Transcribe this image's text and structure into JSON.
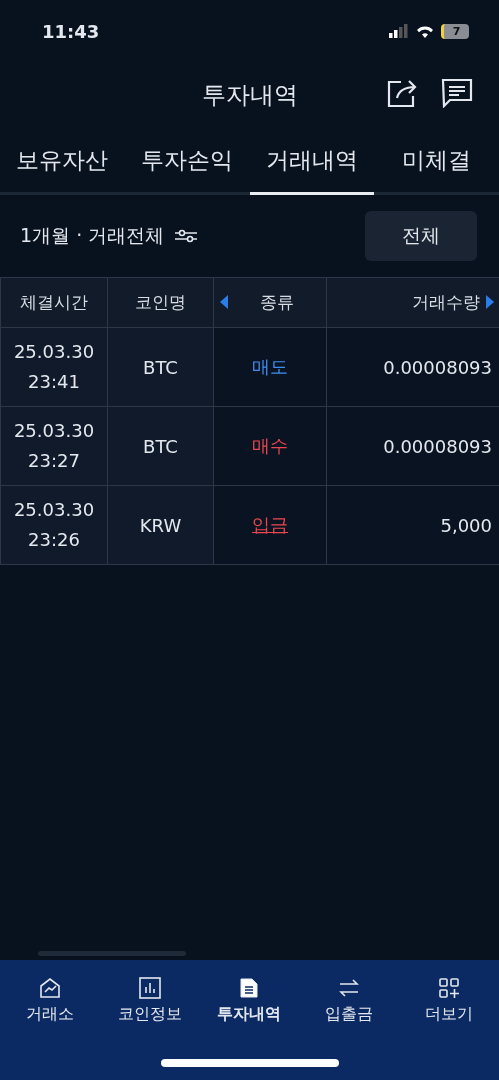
{
  "status_bar": {
    "time": "11:43",
    "battery": "7"
  },
  "header": {
    "title": "투자내역"
  },
  "tabs": [
    {
      "label": "보유자산",
      "selected": false
    },
    {
      "label": "투자손익",
      "selected": false
    },
    {
      "label": "거래내역",
      "selected": true
    },
    {
      "label": "미체결",
      "selected": false
    }
  ],
  "filter": {
    "label": "1개월 · 거래전체",
    "button": "전체"
  },
  "table": {
    "columns": [
      "체결시간",
      "코인명",
      "종류",
      "거래수량"
    ],
    "rows": [
      {
        "date": "25.03.30",
        "time": "23:41",
        "coin": "BTC",
        "type": {
          "label": "매도",
          "kind": "sell"
        },
        "amount": "0.00008093"
      },
      {
        "date": "25.03.30",
        "time": "23:27",
        "coin": "BTC",
        "type": {
          "label": "매수",
          "kind": "buy"
        },
        "amount": "0.00008093"
      },
      {
        "date": "25.03.30",
        "time": "23:26",
        "coin": "KRW",
        "type": {
          "label": "입금",
          "kind": "deposit"
        },
        "amount": "5,000"
      }
    ]
  },
  "bottom_nav": [
    {
      "label": "거래소",
      "kind": "chart",
      "selected": false
    },
    {
      "label": "코인정보",
      "kind": "bars",
      "selected": false
    },
    {
      "label": "투자내역",
      "kind": "doc",
      "selected": true
    },
    {
      "label": "입출금",
      "kind": "swap",
      "selected": false
    },
    {
      "label": "더보기",
      "kind": "grid",
      "selected": false
    }
  ]
}
